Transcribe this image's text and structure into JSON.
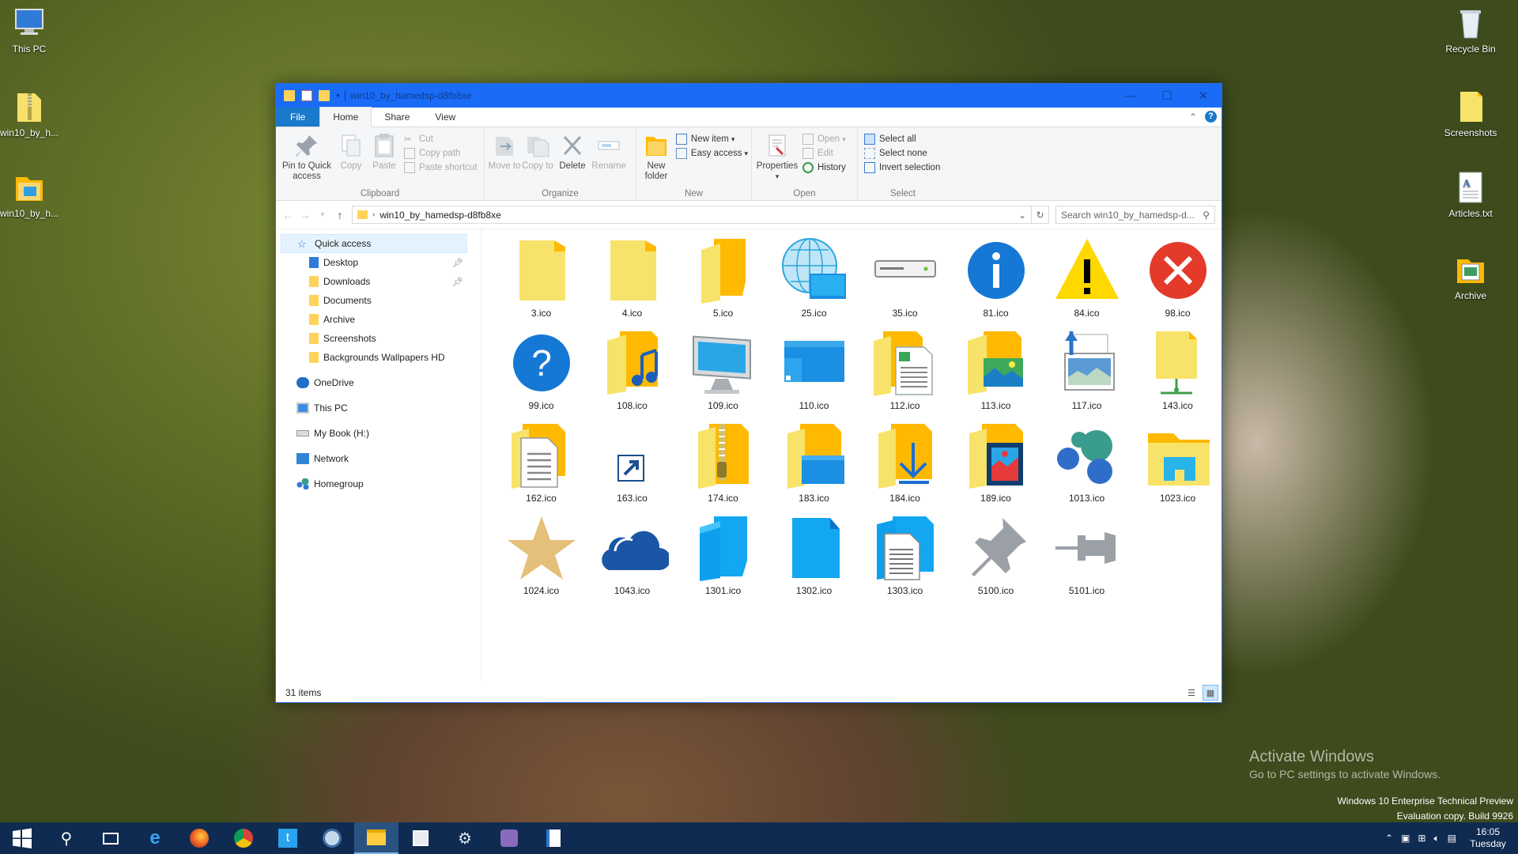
{
  "desktop": {
    "left_icons": [
      {
        "label": "This PC",
        "icon": "this-pc-icon"
      },
      {
        "label": "win10_by_h...",
        "icon": "zip-folder-icon"
      },
      {
        "label": "win10_by_h...",
        "icon": "folder-icon"
      }
    ],
    "right_icons": [
      {
        "label": "Recycle Bin",
        "icon": "recycle-bin-icon"
      },
      {
        "label": "Screenshots",
        "icon": "folder-icon"
      },
      {
        "label": "Articles.txt",
        "icon": "text-file-icon"
      },
      {
        "label": "Archive",
        "icon": "folder-icon"
      }
    ],
    "activate_title": "Activate Windows",
    "activate_sub": "Go to PC settings to activate Windows.",
    "build_line1": "Windows 10 Enterprise Technical Preview",
    "build_line2": "Evaluation copy. Build 9926"
  },
  "window": {
    "title": "win10_by_hamedsp-d8fb8xe",
    "tabs": {
      "file": "File",
      "home": "Home",
      "share": "Share",
      "view": "View"
    },
    "ribbon": {
      "clipboard": {
        "label": "Clipboard",
        "pin": "Pin to Quick access",
        "copy": "Copy",
        "paste": "Paste",
        "cut": "Cut",
        "copy_path": "Copy path",
        "paste_shortcut": "Paste shortcut"
      },
      "organize": {
        "label": "Organize",
        "move_to": "Move to",
        "copy_to": "Copy to",
        "delete": "Delete",
        "rename": "Rename"
      },
      "new": {
        "label": "New",
        "new_folder": "New folder",
        "new_item": "New item",
        "easy_access": "Easy access"
      },
      "open": {
        "label": "Open",
        "properties": "Properties",
        "open": "Open",
        "edit": "Edit",
        "history": "History"
      },
      "select": {
        "label": "Select",
        "select_all": "Select all",
        "select_none": "Select none",
        "invert": "Invert selection"
      }
    },
    "address": {
      "path": "win10_by_hamedsp-d8fb8xe",
      "search_placeholder": "Search win10_by_hamedsp-d..."
    },
    "nav": {
      "quick_access": "Quick access",
      "pinned": [
        {
          "label": "Desktop",
          "pinned": true
        },
        {
          "label": "Downloads",
          "pinned": true
        },
        {
          "label": "Documents",
          "pinned": false
        },
        {
          "label": "Archive",
          "pinned": false
        },
        {
          "label": "Screenshots",
          "pinned": false
        },
        {
          "label": "Backgrounds Wallpapers HD",
          "pinned": false
        }
      ],
      "onedrive": "OneDrive",
      "this_pc": "This PC",
      "mybook": "My Book (H:)",
      "network": "Network",
      "homegroup": "Homegroup"
    },
    "files": [
      {
        "name": "3.ico",
        "icon": "folder-icon"
      },
      {
        "name": "4.ico",
        "icon": "folder-icon"
      },
      {
        "name": "5.ico",
        "icon": "open-folder-icon"
      },
      {
        "name": "25.ico",
        "icon": "globe-screen-icon"
      },
      {
        "name": "35.ico",
        "icon": "drive-icon"
      },
      {
        "name": "81.ico",
        "icon": "info-icon"
      },
      {
        "name": "84.ico",
        "icon": "warning-icon"
      },
      {
        "name": "98.ico",
        "icon": "error-icon"
      },
      {
        "name": "99.ico",
        "icon": "help-icon"
      },
      {
        "name": "108.ico",
        "icon": "music-folder-icon"
      },
      {
        "name": "109.ico",
        "icon": "monitor-icon"
      },
      {
        "name": "110.ico",
        "icon": "desktop-icon"
      },
      {
        "name": "112.ico",
        "icon": "document-folder-icon"
      },
      {
        "name": "113.ico",
        "icon": "pictures-folder-icon"
      },
      {
        "name": "117.ico",
        "icon": "picture-back-icon"
      },
      {
        "name": "143.ico",
        "icon": "network-folder-icon"
      },
      {
        "name": "162.ico",
        "icon": "documents-folder-icon"
      },
      {
        "name": "163.ico",
        "icon": "shortcut-arrow-icon"
      },
      {
        "name": "174.ico",
        "icon": "zip-folder-icon"
      },
      {
        "name": "183.ico",
        "icon": "desktop-folder-icon"
      },
      {
        "name": "184.ico",
        "icon": "downloads-folder-icon"
      },
      {
        "name": "189.ico",
        "icon": "videos-folder-icon"
      },
      {
        "name": "1013.ico",
        "icon": "homegroup-icon"
      },
      {
        "name": "1023.ico",
        "icon": "home-folder-icon"
      },
      {
        "name": "1024.ico",
        "icon": "star-icon"
      },
      {
        "name": "1043.ico",
        "icon": "onedrive-icon"
      },
      {
        "name": "1301.ico",
        "icon": "blue-open-folder-icon"
      },
      {
        "name": "1302.ico",
        "icon": "blue-folder-icon"
      },
      {
        "name": "1303.ico",
        "icon": "blue-document-folder-icon"
      },
      {
        "name": "5100.ico",
        "icon": "pin-icon"
      },
      {
        "name": "5101.ico",
        "icon": "unpin-icon"
      }
    ],
    "status": "31 items"
  },
  "taskbar": {
    "buttons": [
      "start-icon",
      "search-icon",
      "task-view-icon",
      "ie-icon",
      "firefox-icon",
      "chrome-icon",
      "twitter-icon",
      "app-icon",
      "file-explorer-icon",
      "store-icon",
      "steam-icon",
      "app2-icon",
      "document-icon"
    ],
    "time": "16:05",
    "day": "Tuesday"
  }
}
